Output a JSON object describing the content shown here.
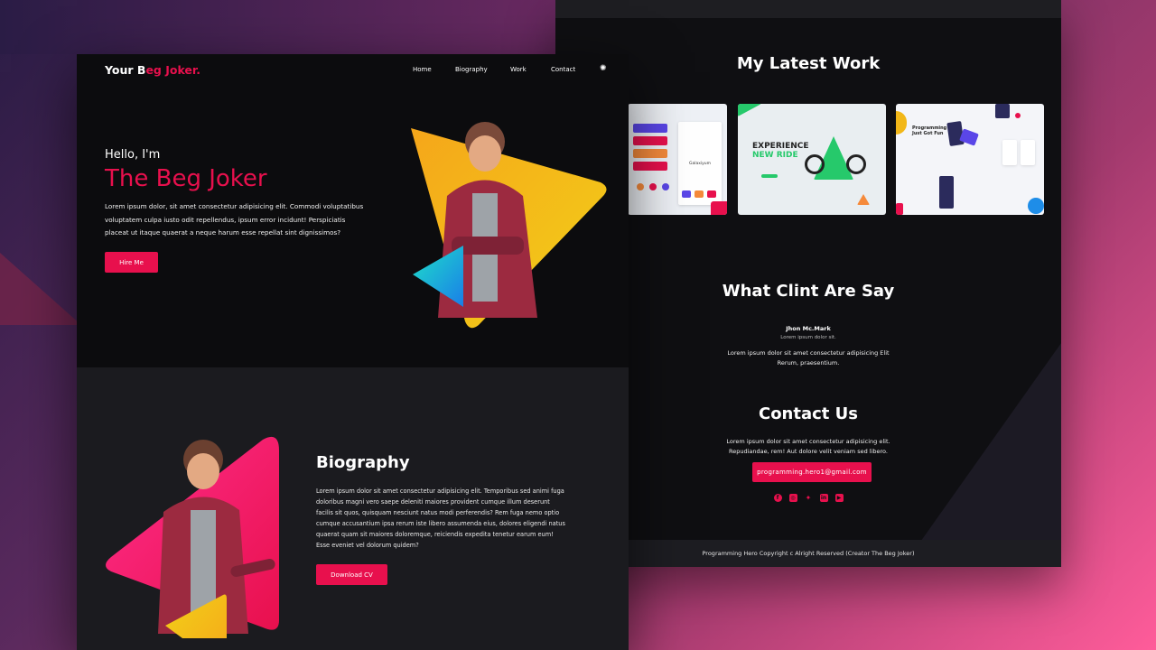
{
  "colors": {
    "accent": "#e8104d",
    "dark_bg": "#0c0c0e",
    "section_bg": "#1b1b1f",
    "yellow": "#f2b718",
    "teal": "#1ec8d6"
  },
  "nav": {
    "brand_prefix": "Your B",
    "brand_accent": "eg Joker.",
    "items": [
      "Home",
      "Biography",
      "Work",
      "Contact"
    ],
    "theme_icon": "sun-icon"
  },
  "hero": {
    "greeting": "Hello, I'm",
    "name": "The Beg Joker",
    "text": "Lorem ipsum dolor, sit amet consectetur adipisicing elit. Commodi voluptatibus voluptatem culpa iusto odit repellendus, ipsum error incidunt! Perspiciatis placeat ut itaque quaerat a neque harum esse repellat sint dignissimos?",
    "button": "Hire Me"
  },
  "biography": {
    "title": "Biography",
    "text": "Lorem ipsum dolor sit amet consectetur adipisicing elit. Temporibus sed animi fuga doloribus magni vero saepe deleniti maiores provident cumque illum deserunt facilis sit quos, quisquam nesciunt natus modi perferendis? Rem fuga nemo optio cumque accusantium ipsa rerum iste libero assumenda eius, dolores eligendi natus quaerat quam sit maiores doloremque, reiciendis expedita tenetur earum eum! Esse eveniet vel dolorum quidem?",
    "button": "Download CV"
  },
  "work": {
    "title": "My Latest Work",
    "cards": [
      {
        "caption": "Galaxiyum"
      },
      {
        "headline_1": "EXPERIENCE",
        "headline_2": "NEW RIDE"
      },
      {
        "headline": "Programming Just Got Fun"
      }
    ]
  },
  "testimonial": {
    "title": "What Clint Are Say",
    "name": "Jhon Mc.Mark",
    "role": "Lorem ipsum dolor sit.",
    "text": "Lorem ipsum dolor sit amet consectetur adipisicing Elit Rerum, praesentium."
  },
  "contact": {
    "title": "Contact Us",
    "text": "Lorem ipsum dolor sit amet consectetur adipisicing elit. Repudiandae, rem! Aut dolore velit veniam sed libero.",
    "email": "programming.hero1@gmail.com",
    "socials": [
      "facebook-icon",
      "instagram-icon",
      "twitter-icon",
      "linkedin-icon",
      "youtube-icon"
    ]
  },
  "footer": {
    "text": "Programming Hero Copyright c Alright Reserved (Creator The Beg Joker)"
  }
}
